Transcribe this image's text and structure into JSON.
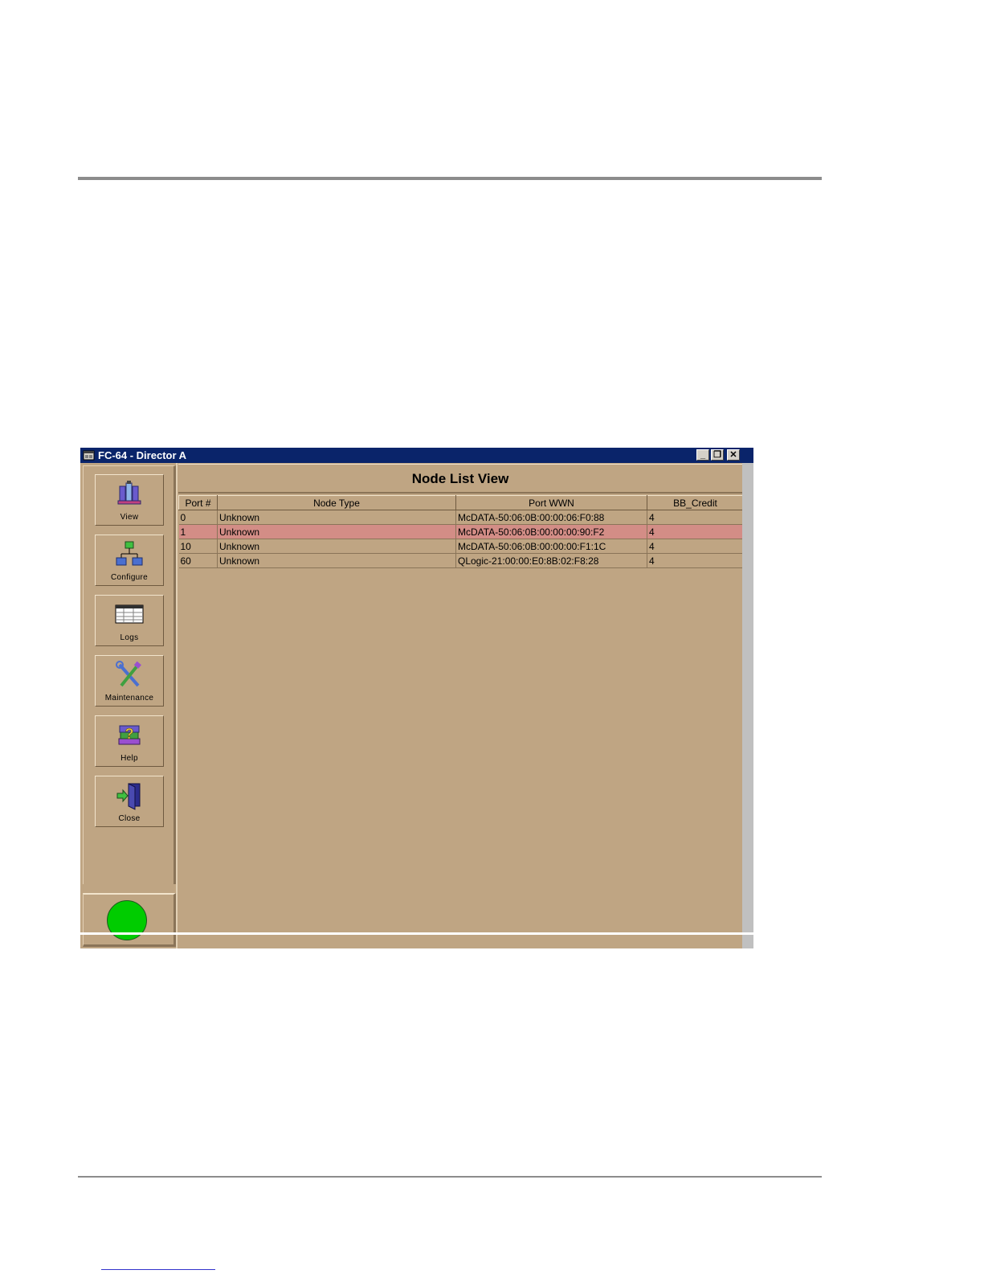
{
  "window": {
    "title": "FC-64 - Director A",
    "controls": {
      "minimize": "_",
      "restore": "❐",
      "close": "✕"
    }
  },
  "sidebar": {
    "items": [
      {
        "label": "View",
        "icon": "view-icon"
      },
      {
        "label": "Configure",
        "icon": "configure-icon"
      },
      {
        "label": "Logs",
        "icon": "logs-icon"
      },
      {
        "label": "Maintenance",
        "icon": "maintenance-icon"
      },
      {
        "label": "Help",
        "icon": "help-icon"
      },
      {
        "label": "Close",
        "icon": "close-door-icon"
      }
    ],
    "status_color": "#00cc00"
  },
  "main": {
    "title": "Node List View",
    "columns": [
      "Port #",
      "Node Type",
      "Port WWN",
      "BB_Credit"
    ],
    "rows": [
      {
        "port": "0",
        "node_type": "Unknown",
        "wwn": "McDATA-50:06:0B:00:00:06:F0:88",
        "bb_credit": "4",
        "selected": false
      },
      {
        "port": "1",
        "node_type": "Unknown",
        "wwn": "McDATA-50:06:0B:00:00:00:90:F2",
        "bb_credit": "4",
        "selected": true
      },
      {
        "port": "10",
        "node_type": "Unknown",
        "wwn": "McDATA-50:06:0B:00:00:00:F1:1C",
        "bb_credit": "4",
        "selected": false
      },
      {
        "port": "60",
        "node_type": "Unknown",
        "wwn": "QLogic-21:00:00:E0:8B:02:F8:28",
        "bb_credit": "4",
        "selected": false
      }
    ],
    "selected_row_color": "#d38d86"
  }
}
